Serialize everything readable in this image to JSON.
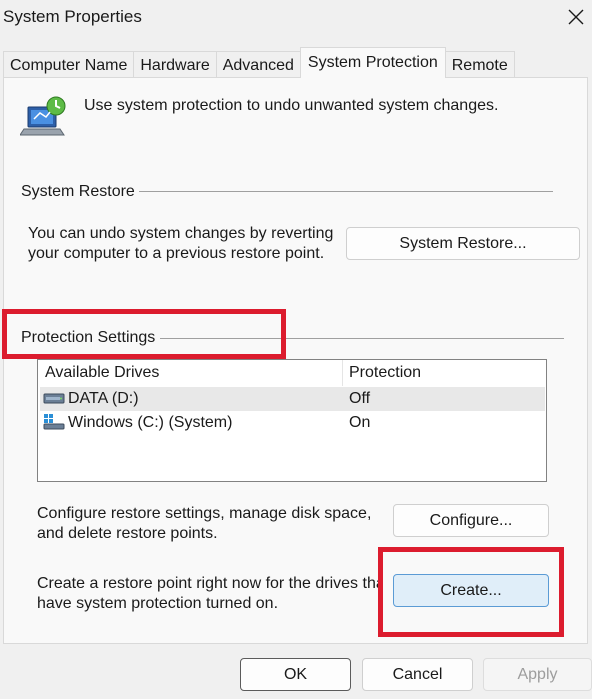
{
  "window": {
    "title": "System Properties",
    "close_icon": "close-icon"
  },
  "tabs": [
    {
      "label": "Computer Name",
      "active": false
    },
    {
      "label": "Hardware",
      "active": false
    },
    {
      "label": "Advanced",
      "active": false
    },
    {
      "label": "System Protection",
      "active": true
    },
    {
      "label": "Remote",
      "active": false
    }
  ],
  "intro": {
    "icon": "system-protection-icon",
    "text": "Use system protection to undo unwanted system changes."
  },
  "system_restore": {
    "group_label": "System Restore",
    "description_line1": "You can undo system changes by reverting",
    "description_line2": "your computer to a previous restore point.",
    "button_label": "System Restore..."
  },
  "protection": {
    "group_label": "Protection Settings",
    "columns": {
      "drive": "Available Drives",
      "protection": "Protection"
    },
    "drives": [
      {
        "name": "DATA (D:)",
        "protection": "Off",
        "icon": "drive-icon",
        "selected": true
      },
      {
        "name": "Windows (C:) (System)",
        "protection": "On",
        "icon": "system-drive-icon",
        "selected": false
      }
    ],
    "configure_line1": "Configure restore settings, manage disk space,",
    "configure_line2": "and delete restore points.",
    "configure_button": "Configure...",
    "create_line1": "Create a restore point right now for the drives tha",
    "create_line2": "have system protection turned on.",
    "create_button": "Create..."
  },
  "footer": {
    "ok": "OK",
    "cancel": "Cancel",
    "apply": "Apply"
  },
  "colors": {
    "highlight": "#dc1c2e",
    "focus_button": "#e0eef9",
    "background": "#f0f0f0"
  }
}
